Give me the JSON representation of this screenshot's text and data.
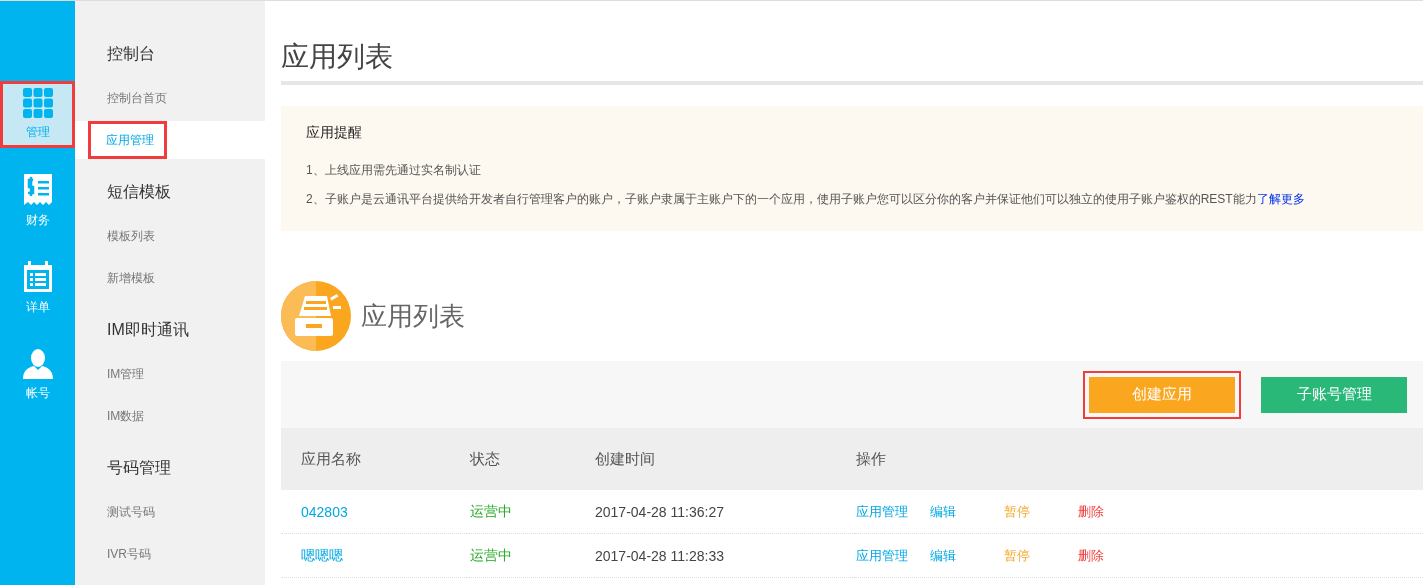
{
  "rail": [
    {
      "label": "管理",
      "selected": true,
      "highlighted": true
    },
    {
      "label": "财务",
      "selected": false,
      "highlighted": false
    },
    {
      "label": "详单",
      "selected": false,
      "highlighted": false
    },
    {
      "label": "帐号",
      "selected": false,
      "highlighted": false
    }
  ],
  "sidebar": {
    "groups": [
      {
        "title": "控制台",
        "items": [
          {
            "label": "控制台首页",
            "selected": false,
            "highlighted": false
          },
          {
            "label": "应用管理",
            "selected": true,
            "highlighted": true
          }
        ]
      },
      {
        "title": "短信模板",
        "items": [
          {
            "label": "模板列表",
            "selected": false,
            "highlighted": false
          },
          {
            "label": "新增模板",
            "selected": false,
            "highlighted": false
          }
        ]
      },
      {
        "title": "IM即时通讯",
        "items": [
          {
            "label": "IM管理",
            "selected": false,
            "highlighted": false
          },
          {
            "label": "IM数据",
            "selected": false,
            "highlighted": false
          }
        ]
      },
      {
        "title": "号码管理",
        "items": [
          {
            "label": "测试号码",
            "selected": false,
            "highlighted": false
          },
          {
            "label": "IVR号码",
            "selected": false,
            "highlighted": false
          }
        ]
      }
    ]
  },
  "page_title": "应用列表",
  "notice": {
    "title": "应用提醒",
    "lines": [
      "1、上线应用需先通过实名制认证",
      "2、子账户是云通讯平台提供给开发者自行管理客户的账户，子账户隶属于主账户下的一个应用，使用子账户您可以区分你的客户并保证他们可以独立的使用子账户鉴权的REST能力"
    ],
    "link": "了解更多"
  },
  "section_title": "应用列表",
  "buttons": [
    {
      "label": "创建应用",
      "kind": "primary",
      "highlighted": true
    },
    {
      "label": "子账号管理",
      "kind": "secondary",
      "highlighted": false
    }
  ],
  "table": {
    "columns": [
      "应用名称",
      "状态",
      "创建时间",
      "操作"
    ],
    "rows": [
      {
        "name": "042803",
        "status": "运营中",
        "color": "#22a822",
        "created": "2017-04-28 11:36:27",
        "actions": [
          {
            "label": "应用管理",
            "kind": "manage"
          },
          {
            "label": "编辑",
            "kind": "edit"
          },
          {
            "label": "暂停",
            "kind": "pause"
          },
          {
            "label": "删除",
            "kind": "delete"
          }
        ]
      },
      {
        "name": "嗯嗯嗯",
        "status": "运营中",
        "color": "#22a822",
        "created": "2017-04-28 11:28:33",
        "actions": [
          {
            "label": "应用管理",
            "kind": "manage"
          },
          {
            "label": "编辑",
            "kind": "edit"
          },
          {
            "label": "暂停",
            "kind": "pause"
          },
          {
            "label": "删除",
            "kind": "delete"
          }
        ]
      }
    ]
  }
}
